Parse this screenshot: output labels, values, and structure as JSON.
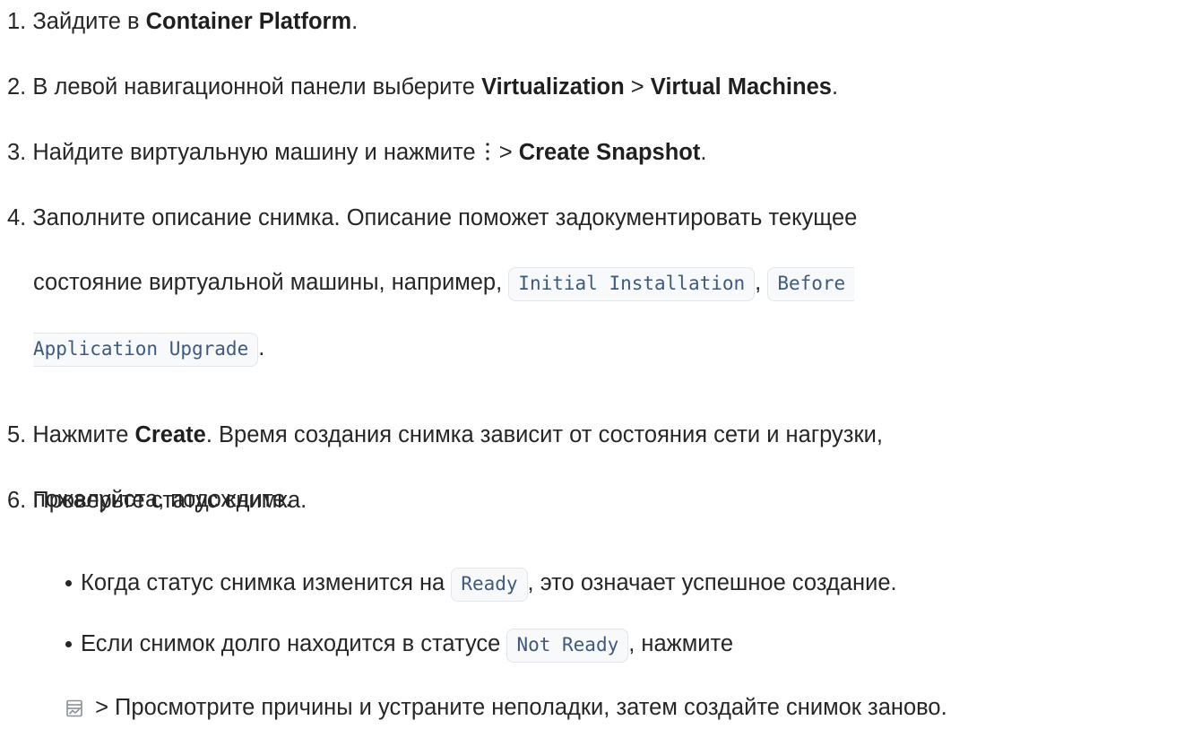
{
  "steps": [
    {
      "num": "1.",
      "prefix": "Зайдите в ",
      "bold": "Container Platform",
      "suffix": "."
    },
    {
      "num": "2.",
      "prefix": "В левой навигационной панели выберите ",
      "bold1": "Virtualization",
      "sep": " > ",
      "bold2": "Virtual Machines",
      "suffix": "."
    },
    {
      "num": "3.",
      "prefix": "Найдите виртуальную машину и нажмите ",
      "icon": "more-vertical-icon",
      "sep": " > ",
      "bold": "Create Snapshot",
      "suffix": "."
    },
    {
      "num": "4.",
      "line1": "Заполните описание снимка. Описание поможет задокументировать текущее",
      "line2_prefix": "состояние виртуальной машины, например, ",
      "code1": "Initial Installation",
      "comma": ", ",
      "code2_part1": "Before",
      "code2_part2": "Application Upgrade",
      "suffix": "."
    },
    {
      "num": "5.",
      "prefix": "Нажмите ",
      "bold": "Create",
      "line1_rest": ". Время создания снимка зависит от состояния сети и нагрузки,",
      "line2": "пожалуйста, подождите."
    },
    {
      "num": "6.",
      "text": "Проверьте статус снимка."
    }
  ],
  "sub_items": [
    {
      "prefix": "Когда статус снимка изменится на ",
      "code": "Ready",
      "suffix": ", это означает успешное создание."
    },
    {
      "prefix": "Если снимок долго находится в статусе ",
      "code": "Not Ready",
      "line1_rest": ", нажмите",
      "icon": "events-list-icon",
      "line2": " > Просмотрите причины и устраните неполадки, затем создайте снимок заново."
    }
  ],
  "colors": {
    "text": "#262626",
    "code_text": "#3d5a80",
    "code_bg": "#f8f9fa",
    "code_border": "#e3e6ea",
    "icon": "#8a8f98"
  }
}
